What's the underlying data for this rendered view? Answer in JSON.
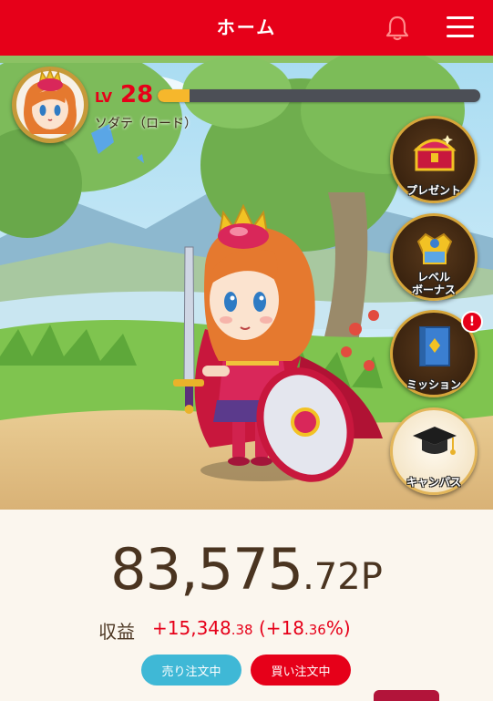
{
  "header": {
    "title": "ホーム",
    "bell_icon": "bell-icon",
    "menu_icon": "hamburger-menu-icon"
  },
  "character": {
    "level_prefix": "LV",
    "level": "28",
    "xp_progress": 0.1,
    "name": "ソダテ（ロード）"
  },
  "side_menu": [
    {
      "label": "プレゼント",
      "icon": "treasure-chest-icon"
    },
    {
      "label_line1": "レベル",
      "label_line2": "ボーナス",
      "icon": "level-bonus-icon"
    },
    {
      "label": "ミッション",
      "icon": "mission-book-icon",
      "badge": "!"
    },
    {
      "label": "キャンパス",
      "icon": "graduation-cap-icon"
    }
  ],
  "summary": {
    "points_integer": "83,575",
    "points_decimal": ".72",
    "points_unit": "P",
    "profit_label": "収益",
    "profit_integer": "+15,348",
    "profit_decimal": ".38",
    "profit_pct_open": "(+18",
    "profit_pct_decimal": ".36",
    "profit_pct_close": "%)"
  },
  "orders": {
    "sell_label": "売り注文中",
    "buy_label": "買い注文中"
  },
  "colors": {
    "brand_red": "#e60019",
    "sell_blue": "#3fb8d6",
    "xp_yellow": "#f6b72c"
  }
}
